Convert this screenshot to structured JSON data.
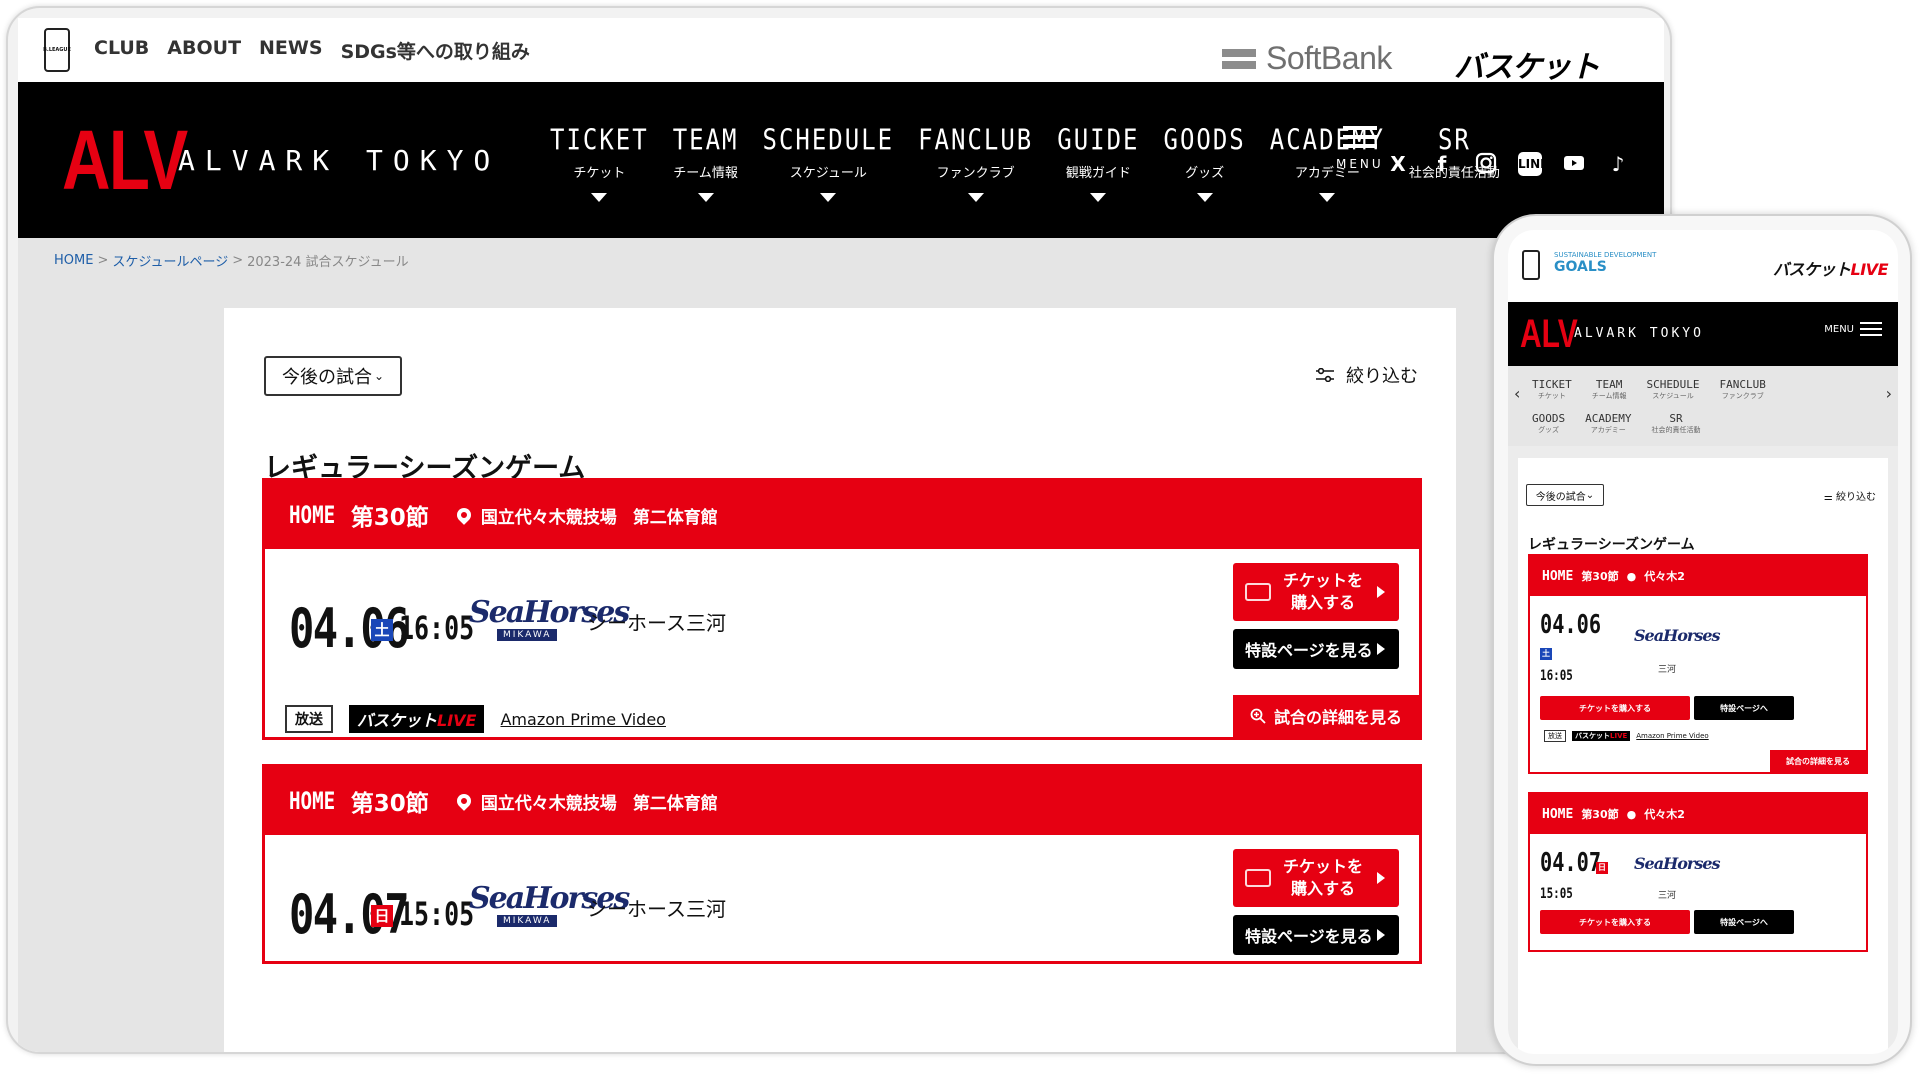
{
  "desktop": {
    "top_links": [
      "CLUB",
      "ABOUT",
      "NEWS",
      "SDGs等への取り組み"
    ],
    "bleague_mark": "B.LEAGUE",
    "sponsor": "SoftBank",
    "basket_live": {
      "main": "バスケット",
      "accent": "LIVE"
    },
    "logo": "ALV",
    "team_name": "ALVARK TOKYO",
    "nav": [
      {
        "en": "TICKET",
        "ja": "チケット"
      },
      {
        "en": "TEAM",
        "ja": "チーム情報"
      },
      {
        "en": "SCHEDULE",
        "ja": "スケジュール"
      },
      {
        "en": "FANCLUB",
        "ja": "ファンクラブ"
      },
      {
        "en": "GUIDE",
        "ja": "観戦ガイド"
      },
      {
        "en": "GOODS",
        "ja": "グッズ"
      },
      {
        "en": "ACADEMY",
        "ja": "アカデミー"
      },
      {
        "en": "SR",
        "ja": "社会的責任活動"
      }
    ],
    "menu_label": "MENU",
    "socials": [
      "x-icon",
      "facebook-icon",
      "instagram-icon",
      "line-icon",
      "youtube-icon",
      "tiktok-icon"
    ],
    "breadcrumb": {
      "home": "HOME",
      "schedule": "スケジュールページ",
      "current": "2023-24 試合スケジュール",
      "sep": ">"
    },
    "filter_select": "今後の試合",
    "narrow_label": "絞り込む",
    "section_title": "レギュラーシーズンゲーム",
    "games": [
      {
        "home": "HOME",
        "setsu": "第30節",
        "venue": "国立代々木競技場",
        "hall": "第二体育館",
        "date": "04.06",
        "dow": "土",
        "time": "16:05",
        "opp_logo_main": "SeaHorses",
        "opp_logo_sub": "MIKAWA",
        "opponent": "シーホース三河",
        "ticket_btn": "チケットを\n購入する",
        "special_btn": "特設ページを見る",
        "broadcast_tag": "放送",
        "broadcast_link": "Amazon Prime Video",
        "detail_btn": "試合の詳細を見る"
      },
      {
        "home": "HOME",
        "setsu": "第30節",
        "venue": "国立代々木競技場",
        "hall": "第二体育館",
        "date": "04.07",
        "dow": "日",
        "time": "15:05",
        "opp_logo_main": "SeaHorses",
        "opp_logo_sub": "MIKAWA",
        "opponent": "シーホース三河",
        "ticket_btn": "チケットを\n購入する",
        "special_btn": "特設ページを見る"
      }
    ]
  },
  "mobile": {
    "sdg_small": "SUSTAINABLE DEVELOPMENT",
    "sdg_goals": "GOALS",
    "basket_live": {
      "main": "バスケット",
      "accent": "LIVE"
    },
    "logo": "ALV",
    "team_name": "ALVARK TOKYO",
    "menu_label": "MENU",
    "nav_row1": [
      {
        "en": "TICKET",
        "ja": "チケット"
      },
      {
        "en": "TEAM",
        "ja": "チーム情報"
      },
      {
        "en": "SCHEDULE",
        "ja": "スケジュール"
      },
      {
        "en": "FANCLUB",
        "ja": "ファンクラブ"
      }
    ],
    "nav_row2": [
      {
        "en": "GOODS",
        "ja": "グッズ"
      },
      {
        "en": "ACADEMY",
        "ja": "アカデミー"
      },
      {
        "en": "SR",
        "ja": "社会的責任活動"
      }
    ],
    "filter_select": "今後の試合",
    "narrow_label": "絞り込む",
    "section_title": "レギュラーシーズンゲーム",
    "games": [
      {
        "home": "HOME",
        "setsu": "第30節",
        "venue": "代々木2",
        "date": "04.06",
        "dow": "土",
        "time": "16:05",
        "opp_logo": "SeaHorses",
        "opponent": "三河",
        "ticket_btn": "チケットを購入する",
        "special_btn": "特設ページへ",
        "bc_tag": "放送",
        "bc_link": "Amazon Prime Video",
        "detail_btn": "試合の詳細を見る"
      },
      {
        "home": "HOME",
        "setsu": "第30節",
        "venue": "代々木2",
        "date": "04.07",
        "dow": "日",
        "time": "15:05",
        "opp_logo": "SeaHorses",
        "opponent": "三河",
        "ticket_btn": "チケットを購入する",
        "special_btn": "特設ページへ"
      }
    ]
  },
  "colors": {
    "brand_red": "#e60012",
    "navbar": "#000000",
    "saturday": "#1a47b8"
  }
}
